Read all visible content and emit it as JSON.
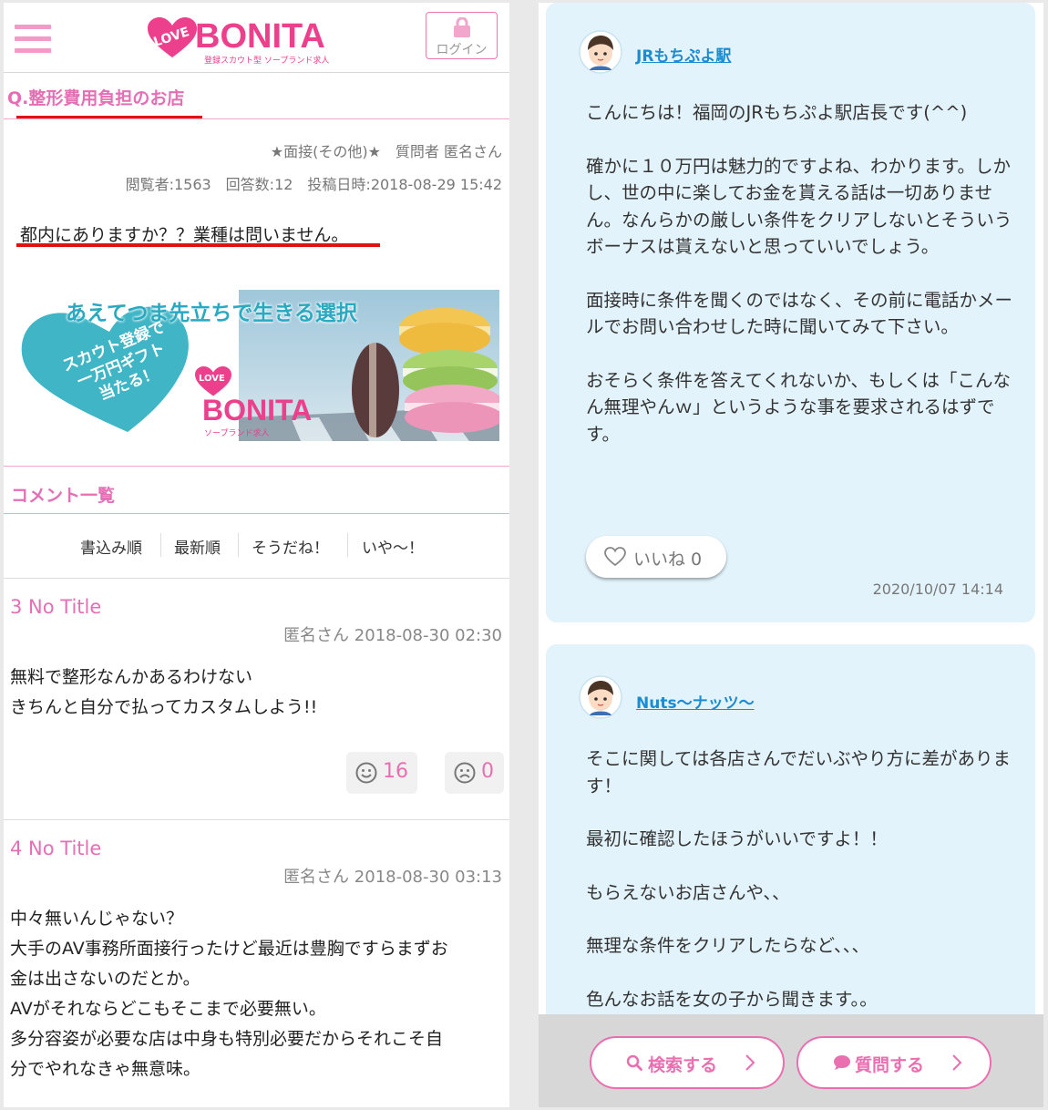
{
  "header": {
    "logo_heart": "LOVE",
    "logo_word": "BONITA",
    "logo_sub": "登録スカウト型 ソープランド求人",
    "login_label": "ログイン"
  },
  "question": {
    "title": "Q.整形費用負担のお店",
    "category_line": "★面接(その他)★　質問者 匿名さん",
    "stats_line": "閲覧者:1563　回答数:12　投稿日時:2018-08-29 15:42",
    "body": "都内にありますか？？業種は問いません。"
  },
  "banner": {
    "headline": "あえてつま先立ちで生きる選択",
    "heart_text": [
      "スカウト登録で",
      "一万円ギフト",
      "当たる！"
    ],
    "logo_heart": "LOVE",
    "logo_word": "BONITA",
    "logo_sub": "ソープランド求人"
  },
  "comments_section": {
    "title": "コメント一覧",
    "sort_options": [
      "書込み順",
      "最新順",
      "そうだね！",
      "いや〜！"
    ]
  },
  "comments": [
    {
      "title": "3 No Title",
      "meta": "匿名さん 2018-08-30 02:30",
      "lines": [
        "無料で整形なんかあるわけない",
        "きちんと自分で払ってカスタムしよう!!"
      ],
      "agree": "16",
      "disagree": "0"
    },
    {
      "title": "4 No Title",
      "meta": "匿名さん 2018-08-30 03:13",
      "lines": [
        "中々無いんじゃない？",
        "大手のAV事務所面接行ったけど最近は豊胸ですらまずお",
        "金は出さないのだとか。",
        "AVがそれならどこもそこまで必要無い。",
        "多分容姿が必要な店は中身も特別必要だからそれこそ自",
        "分でやれなきゃ無意味。"
      ]
    }
  ],
  "answers": [
    {
      "user": "JRもちぷよ駅",
      "paragraphs": [
        "こんにちは！福岡のJRもちぷよ駅店長です(^^)",
        "確かに１０万円は魅力的ですよね、わかります。しかし、世の中に楽してお金を貰える話は一切ありません。なんらかの厳しい条件をクリアしないとそういうボーナスは貰えないと思っていいでしょう。",
        "面接時に条件を聞くのではなく、その前に電話かメールでお問い合わせした時に聞いてみて下さい。",
        "おそらく条件を答えてくれないか、もしくは「こんなん無理やんｗ」というような事を要求されるはずです。"
      ],
      "like_label": "いいね 0",
      "date": "2020/10/07 14:14"
    },
    {
      "user": "Nuts〜ナッツ〜",
      "paragraphs": [
        "そこに関しては各店さんでだいぶやり方に差があります！",
        "最初に確認したほうがいいですよ！！",
        "もらえないお店さんや、、",
        "無理な条件をクリアしたらなど、、、",
        "色んなお話を女の子から聞きます。。"
      ]
    }
  ],
  "bottom_bar": {
    "search_label": "検索する",
    "ask_label": "質問する"
  },
  "colors": {
    "brand_pink": "#ec3f8c",
    "title_pink": "#e56fb4",
    "answer_bg": "#e3f3fb",
    "link_blue": "#1c8bd0",
    "underline_red": "#e01212"
  }
}
